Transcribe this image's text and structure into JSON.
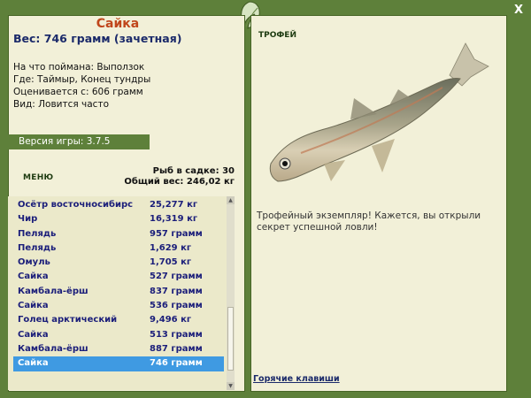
{
  "window": {
    "close_label": "X"
  },
  "catch": {
    "name": "Сайка",
    "weight_line": "Вес: 746 грамм (зачетная)",
    "info": [
      "На что поймана: Выползок",
      "Где: Таймыр, Конец тундры",
      "Оценивается с: 606 грамм",
      "Вид: Ловится часто"
    ]
  },
  "version": "Версия игры: 3.7.5",
  "menu_label": "МЕНЮ",
  "stats": {
    "count_line": "Рыб в садке: 30",
    "total_line": "Общий вес: 246,02 кг"
  },
  "catch_list": [
    {
      "name": "Осётр восточносибирс...",
      "weight": "25,277 кг"
    },
    {
      "name": "Чир",
      "weight": "16,319 кг"
    },
    {
      "name": "Пелядь",
      "weight": "957 грамм"
    },
    {
      "name": "Пелядь",
      "weight": "1,629 кг"
    },
    {
      "name": "Омуль",
      "weight": "1,705 кг"
    },
    {
      "name": "Сайка",
      "weight": "527 грамм"
    },
    {
      "name": "Камбала-ёрш",
      "weight": "837 грамм"
    },
    {
      "name": "Сайка",
      "weight": "536 грамм"
    },
    {
      "name": "Голец арктический",
      "weight": "9,496 кг"
    },
    {
      "name": "Сайка",
      "weight": "513 грамм"
    },
    {
      "name": "Камбала-ёрш",
      "weight": "887 грамм"
    },
    {
      "name": "Сайка",
      "weight": "746 грамм"
    }
  ],
  "selected_index": 11,
  "trophy": {
    "title": "ТРОФЕЙ",
    "text": "Трофейный экземпляр! Кажется, вы открыли секрет успешной ловли!"
  },
  "hotkeys_label": "Горячие клавиши",
  "colors": {
    "frame": "#5e803a",
    "panel": "#f2f0d8",
    "fish_name": "#c0461b",
    "list_text": "#1b1e7a",
    "selected_row": "#3f9ae2"
  }
}
